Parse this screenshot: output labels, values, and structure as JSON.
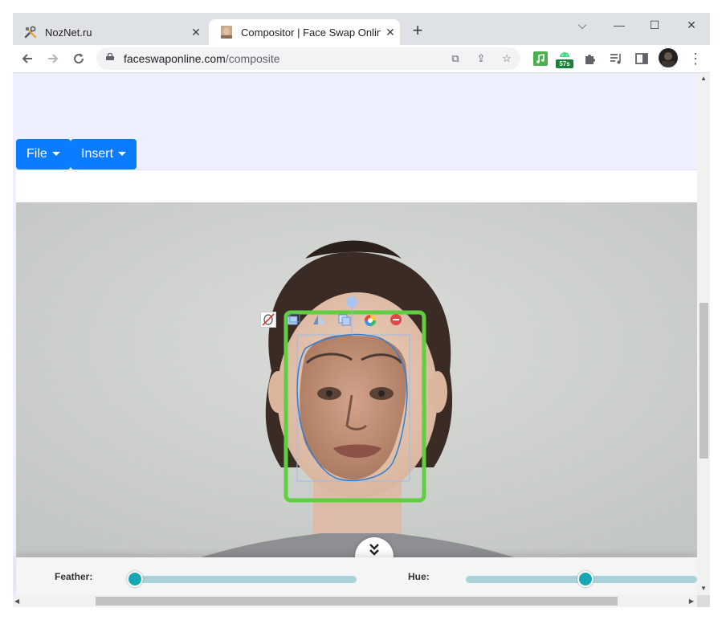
{
  "browser": {
    "tabs": [
      {
        "title": "NozNet.ru",
        "favicon": "tools-icon",
        "active": false
      },
      {
        "title": "Compositor | Face Swap Online",
        "favicon": "face-thumbnail-icon",
        "active": true
      }
    ],
    "url_domain": "faceswaponline.com",
    "url_path": "/composite",
    "extension_badge": "57s",
    "colors": {
      "tabbar": "#dee1e6",
      "omnibox": "#f1f3f4"
    }
  },
  "menu": {
    "file_label": "File",
    "insert_label": "Insert",
    "button_color": "#0b7bff"
  },
  "editor": {
    "feather_label": "Feather:",
    "hue_label": "Hue:",
    "feather_value": 0.0,
    "hue_value": 0.52,
    "selection_color": "#5fcf3f",
    "slider_color": "#15a8b4",
    "face_tools": [
      "hide-mask-icon",
      "layer-icon",
      "flip-icon",
      "duplicate-icon",
      "color-wheel-icon",
      "delete-icon"
    ]
  }
}
